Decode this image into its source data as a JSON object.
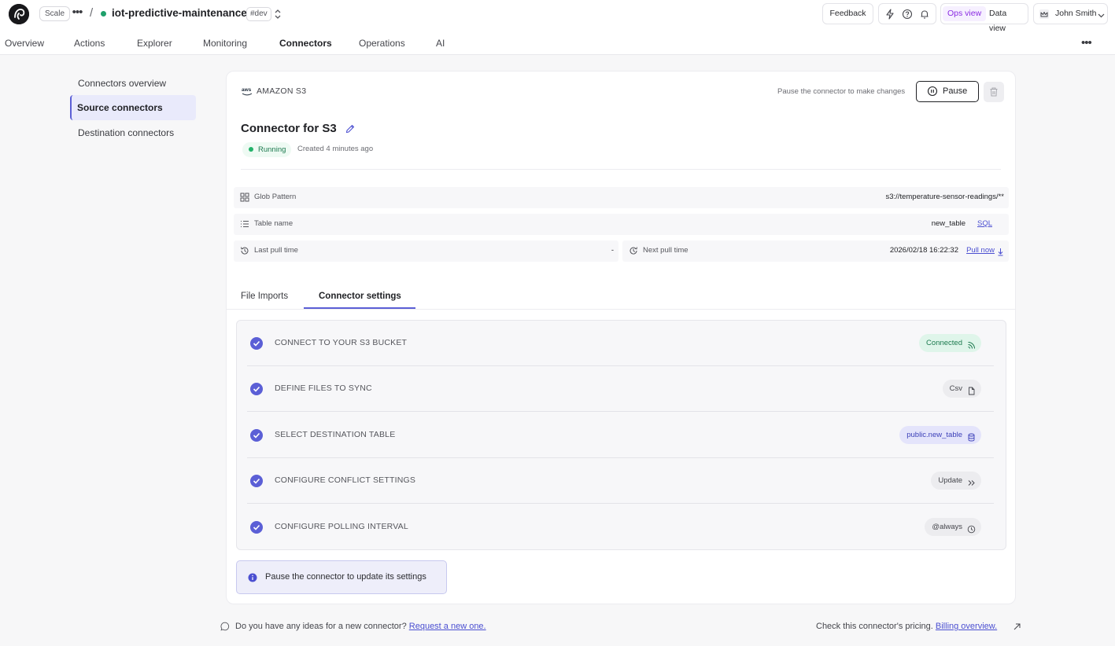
{
  "header": {
    "plan": "Scale",
    "project": "iot-predictive-maintenance",
    "env": "#dev",
    "feedback": "Feedback",
    "ops_view": "Ops view",
    "data_view": "Data view",
    "user": "John Smith"
  },
  "nav": {
    "items": [
      "Overview",
      "Actions",
      "Explorer",
      "Monitoring",
      "Connectors",
      "Operations",
      "AI"
    ],
    "active": "Connectors"
  },
  "sidebar": {
    "items": [
      {
        "label": "Connectors overview"
      },
      {
        "label": "Source connectors"
      },
      {
        "label": "Destination connectors"
      }
    ]
  },
  "card": {
    "source": "AMAZON S3",
    "pause_hint": "Pause the connector to make changes",
    "pause_label": "Pause",
    "title": "Connector for S3",
    "status": "Running",
    "created": "Created 4 minutes ago",
    "glob_label": "Glob Pattern",
    "glob_value": "s3://temperature-sensor-readings/**",
    "table_label": "Table name",
    "table_value": "new_table",
    "sql_link": "SQL",
    "last_pull_label": "Last pull time",
    "last_pull_value": "-",
    "next_pull_label": "Next pull time",
    "next_pull_value": "2026/02/18 16:22:32",
    "pull_now": "Pull now"
  },
  "tabs": [
    "File Imports",
    "Connector settings"
  ],
  "steps": [
    {
      "label": "CONNECT TO YOUR S3 BUCKET",
      "chip": "Connected"
    },
    {
      "label": "DEFINE FILES TO SYNC",
      "chip": "Csv"
    },
    {
      "label": "SELECT DESTINATION TABLE",
      "chip": "public.new_table"
    },
    {
      "label": "CONFIGURE CONFLICT SETTINGS",
      "chip": "Update"
    },
    {
      "label": "CONFIGURE POLLING INTERVAL",
      "chip": "@always"
    }
  ],
  "notice": "Pause the connector to update its settings",
  "footer": {
    "ideas_text": "Do you have any ideas for a new connector?",
    "ideas_link": "Request a new one.",
    "pricing_text": "Check this connector's pricing.",
    "pricing_link": "Billing overview."
  },
  "colors": {
    "accent": "#5b5fd6",
    "running": "#22b26a",
    "ops_view": "#8a2be2"
  }
}
